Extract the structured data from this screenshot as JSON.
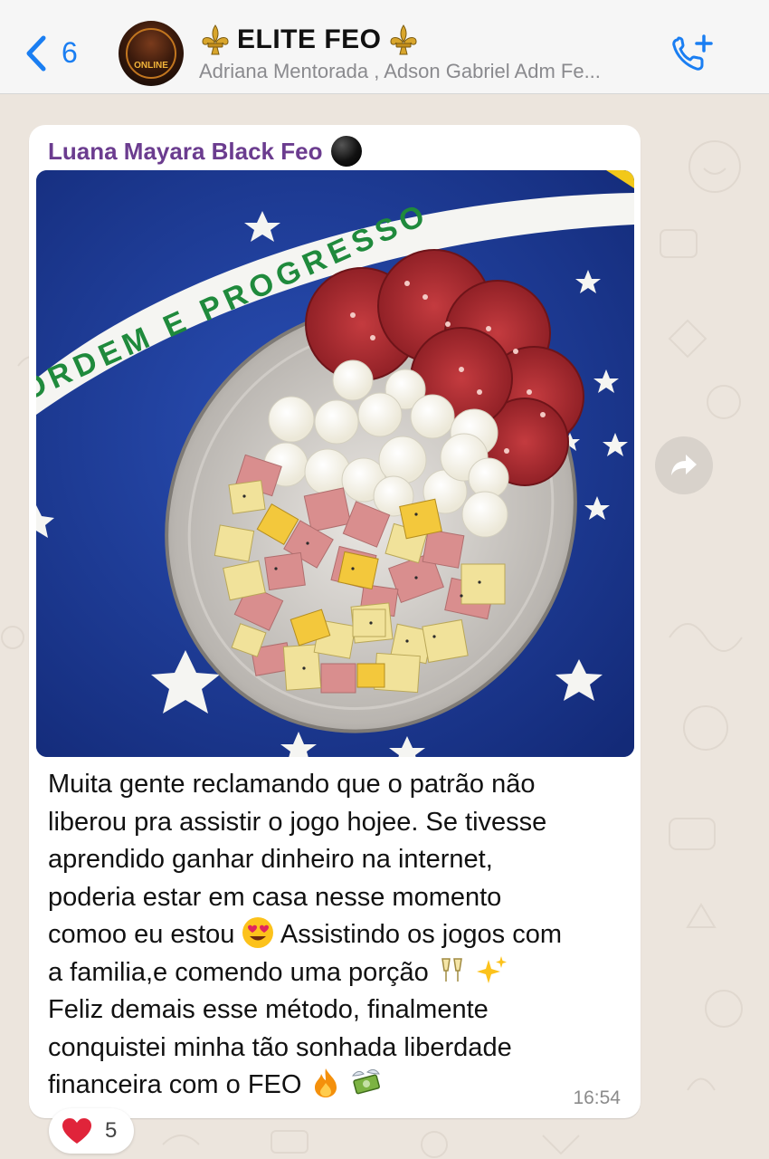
{
  "header": {
    "back_count": "6",
    "title": "ELITE FEO",
    "subtitle": "Adriana Mentorada , Adson Gabriel Adm Fe...",
    "avatar_text": "ONLINE"
  },
  "message": {
    "sender": "Luana Mayara Black Feo",
    "photo_banner_text": "ORDEM E PROGRESSO",
    "lines": [
      "Muita gente reclamando que o patrão não",
      "liberou pra assistir o jogo hojee. Se tivesse",
      "aprendido ganhar dinheiro na internet,",
      "poderia estar em casa nesse momento",
      "comoo eu estou",
      "Assistindo os jogos com",
      "a familia,e  comendo uma porção",
      "Feliz demais esse método, finalmente",
      "conquistei minha tão sonhada liberdade",
      "financeira com o FEO"
    ],
    "time": "16:54",
    "reaction_count": "5"
  },
  "icons": {
    "back": "chevron-left-icon",
    "call_add": "phone-add-icon",
    "forward": "forward-icon",
    "reaction": "heart-icon"
  },
  "colors": {
    "accent": "#1a7ef2",
    "sender": "#6b3c8f",
    "chat_bg": "#ece5dd",
    "bubble_bg": "#ffffff"
  }
}
